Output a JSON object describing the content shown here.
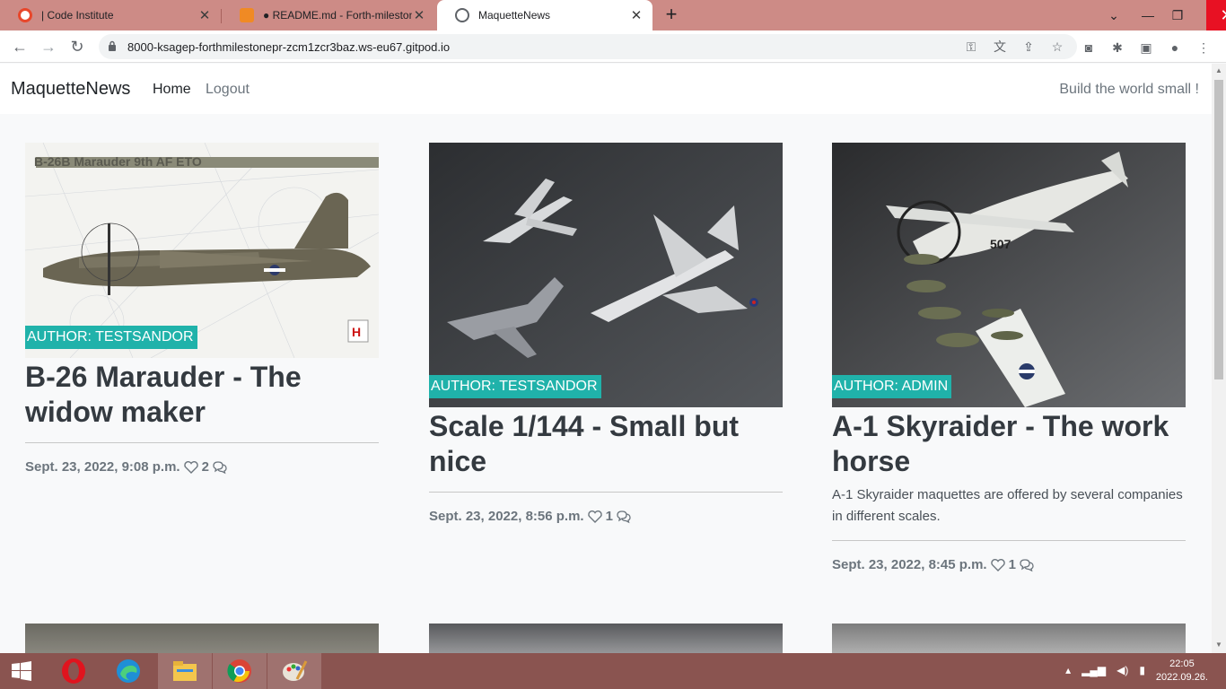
{
  "browser": {
    "tabs": [
      {
        "title": "| Code Institute",
        "color": "#e8472b"
      },
      {
        "title": "● README.md - Forth-milestone",
        "color": "#f08a24"
      },
      {
        "title": "MaquetteNews",
        "color": "#5f6368"
      }
    ],
    "url": "8000-ksagep-forthmilestonepr-zcm1zcr3baz.ws-eu67.gitpod.io"
  },
  "site": {
    "brand": "MaquetteNews",
    "nav": {
      "home": "Home",
      "logout": "Logout"
    },
    "tagline": "Build the world small !"
  },
  "posts": [
    {
      "author": "AUTHOR: TESTSANDOR",
      "title": "B-26 Marauder - The widow maker",
      "excerpt": "",
      "date": "Sept. 23, 2022, 9:08 p.m.",
      "likes": "2",
      "image_text": "B-26B Marauder 9th AF ETO"
    },
    {
      "author": "AUTHOR: TESTSANDOR",
      "title": "Scale 1/144 - Small but nice",
      "excerpt": "",
      "date": "Sept. 23, 2022, 8:56 p.m.",
      "likes": "1"
    },
    {
      "author": "AUTHOR: ADMIN",
      "title": "A-1 Skyraider - The work horse",
      "excerpt": "A-1 Skyraider maquettes are offered by several companies in different scales.",
      "date": "Sept. 23, 2022, 8:45 p.m.",
      "likes": "1"
    }
  ],
  "taskbar": {
    "time": "22:05",
    "date": "2022.09.26."
  },
  "colors": {
    "accent": "#20b2aa",
    "tabstrip": "#cd8b86",
    "taskbar": "#8a5450"
  }
}
